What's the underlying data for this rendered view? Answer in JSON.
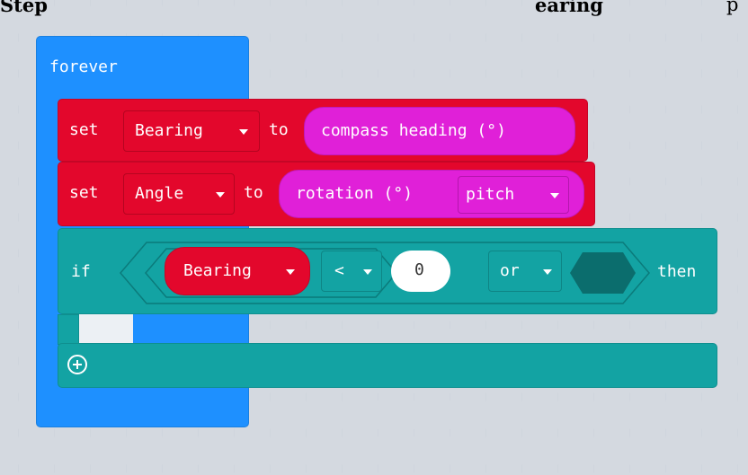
{
  "heading": {
    "text_left": "Step",
    "text_right": "earing",
    "text_far": "p"
  },
  "forever": {
    "label": "forever"
  },
  "set1": {
    "set_label": "set",
    "variable": "Bearing",
    "to_label": "to",
    "value": "compass heading (°)"
  },
  "set2": {
    "set_label": "set",
    "variable": "Angle",
    "to_label": "to",
    "value": "rotation (°)",
    "axis": "pitch"
  },
  "if_block": {
    "if_label": "if",
    "compare_left": "Bearing",
    "operator": "<",
    "number": "0",
    "logic": "or",
    "then_label": "then",
    "add_icon": "plus-circle-icon"
  },
  "colors": {
    "loops": "#1e90ff",
    "variables": "#e3072c",
    "input": "#e020d8",
    "logic": "#13a3a3",
    "workspace": "#ecf0f4"
  }
}
